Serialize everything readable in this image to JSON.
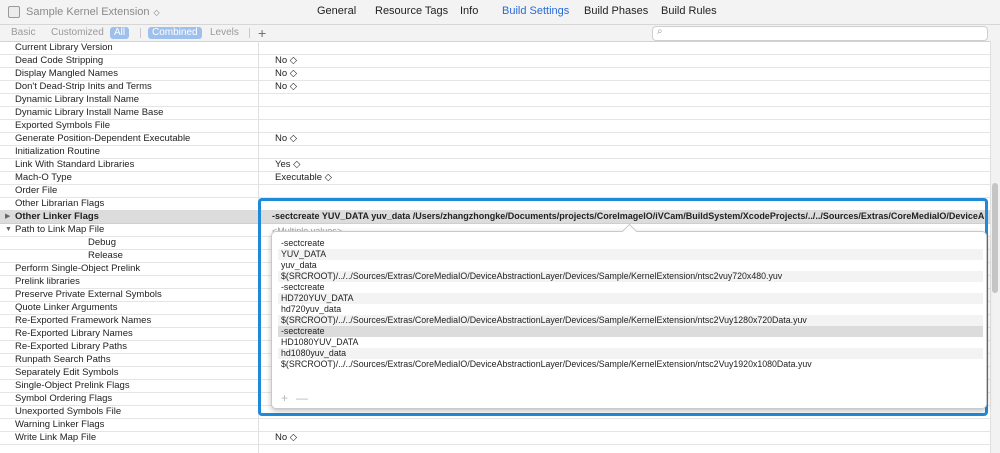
{
  "target": {
    "name": "Sample Kernel Extension"
  },
  "tabs": [
    {
      "label": "General",
      "active": false
    },
    {
      "label": "Resource Tags",
      "active": false
    },
    {
      "label": "Info",
      "active": false
    },
    {
      "label": "Build Settings",
      "active": true
    },
    {
      "label": "Build Phases",
      "active": false
    },
    {
      "label": "Build Rules",
      "active": false
    }
  ],
  "filters": {
    "basic": "Basic",
    "customized": "Customized",
    "all": "All",
    "combined": "Combined",
    "levels": "Levels",
    "add": "+",
    "search_placeholder": ""
  },
  "settings": [
    {
      "name": "Current Library Version",
      "value": ""
    },
    {
      "name": "Dead Code Stripping",
      "value": "No ◇"
    },
    {
      "name": "Display Mangled Names",
      "value": "No ◇"
    },
    {
      "name": "Don't Dead-Strip Inits and Terms",
      "value": "No ◇"
    },
    {
      "name": "Dynamic Library Install Name",
      "value": ""
    },
    {
      "name": "Dynamic Library Install Name Base",
      "value": ""
    },
    {
      "name": "Exported Symbols File",
      "value": ""
    },
    {
      "name": "Generate Position-Dependent Executable",
      "value": "No ◇"
    },
    {
      "name": "Initialization Routine",
      "value": ""
    },
    {
      "name": "Link With Standard Libraries",
      "value": "Yes ◇"
    },
    {
      "name": "Mach-O Type",
      "value": "Executable ◇"
    },
    {
      "name": "Order File",
      "value": ""
    },
    {
      "name": "Other Librarian Flags",
      "value": ""
    },
    {
      "name": "Other Linker Flags",
      "value": ""
    },
    {
      "name": "Path to Link Map File",
      "value": ""
    },
    {
      "name": "Debug",
      "value": ""
    },
    {
      "name": "Release",
      "value": ""
    },
    {
      "name": "Perform Single-Object Prelink",
      "value": ""
    },
    {
      "name": "Prelink libraries",
      "value": ""
    },
    {
      "name": "Preserve Private External Symbols",
      "value": ""
    },
    {
      "name": "Quote Linker Arguments",
      "value": ""
    },
    {
      "name": "Re-Exported Framework Names",
      "value": ""
    },
    {
      "name": "Re-Exported Library Names",
      "value": ""
    },
    {
      "name": "Re-Exported Library Paths",
      "value": ""
    },
    {
      "name": "Runpath Search Paths",
      "value": ""
    },
    {
      "name": "Separately Edit Symbols",
      "value": ""
    },
    {
      "name": "Single-Object Prelink Flags",
      "value": ""
    },
    {
      "name": "Symbol Ordering Flags",
      "value": ""
    },
    {
      "name": "Unexported Symbols File",
      "value": ""
    },
    {
      "name": "Warning Linker Flags",
      "value": ""
    },
    {
      "name": "Write Link Map File",
      "value": "No ◇"
    }
  ],
  "linker_flags_value": "-sectcreate YUV_DATA yuv_data /Users/zhangzhongke/Documents/projects/CoreImageIO/iVCam/BuildSystem/XcodeProjects/../../Sources/Extras/CoreMediaIO/DeviceAbstr...",
  "multiple_values": "<Multiple values>",
  "popover_items": [
    "-sectcreate",
    "YUV_DATA",
    "yuv_data",
    "$(SRCROOT)/../../Sources/Extras/CoreMediaIO/DeviceAbstractionLayer/Devices/Sample/KernelExtension/ntsc2vuy720x480.yuv",
    "-sectcreate",
    "HD720YUV_DATA",
    "hd720yuv_data",
    "$(SRCROOT)/../../Sources/Extras/CoreMediaIO/DeviceAbstractionLayer/Devices/Sample/KernelExtension/ntsc2Vuy1280x720Data.yuv",
    "-sectcreate",
    "HD1080YUV_DATA",
    "hd1080yuv_data",
    "$(SRCROOT)/../../Sources/Extras/CoreMediaIO/DeviceAbstractionLayer/Devices/Sample/KernelExtension/ntsc2Vuy1920x1080Data.yuv"
  ],
  "popover_actions": {
    "add": "+",
    "remove": "—"
  }
}
